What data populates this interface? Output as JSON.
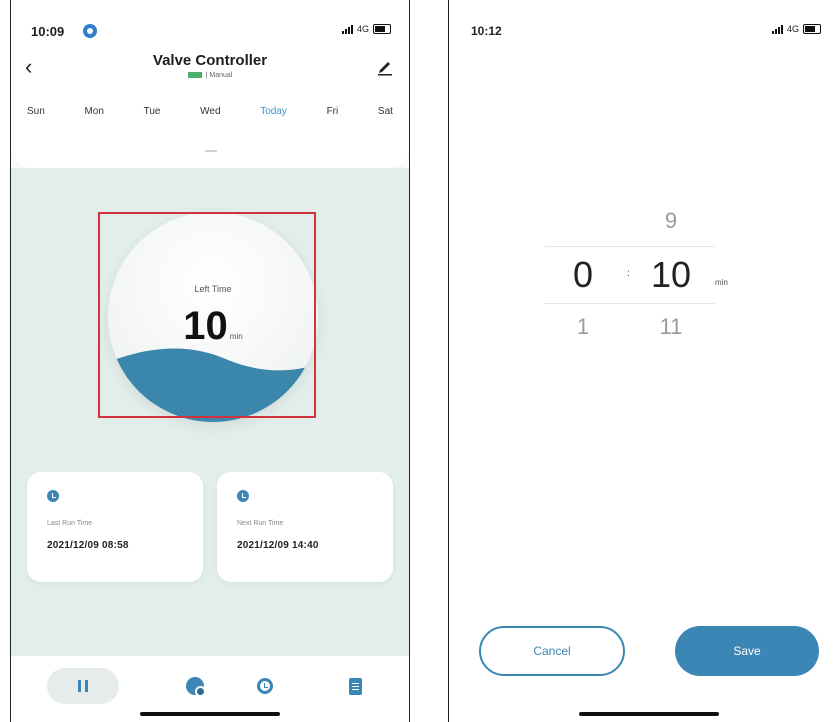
{
  "left_screen": {
    "status": {
      "time": "10:09",
      "network": "4G"
    },
    "header": {
      "title": "Valve Controller",
      "mode": "Manual"
    },
    "days": [
      {
        "label": "Sun",
        "active": false
      },
      {
        "label": "Mon",
        "active": false
      },
      {
        "label": "Tue",
        "active": false
      },
      {
        "label": "Wed",
        "active": false
      },
      {
        "label": "Today",
        "active": true
      },
      {
        "label": "Fri",
        "active": false
      },
      {
        "label": "Sat",
        "active": false
      }
    ],
    "timer": {
      "label": "Left Time",
      "value": "10",
      "unit": "min"
    },
    "last_run": {
      "label": "Last Run Time",
      "value": "2021/12/09 08:58"
    },
    "next_run": {
      "label": "Next Run Time",
      "value": "2021/12/09 14:40"
    },
    "tabs": [
      "pause",
      "timer-icon",
      "alarm-clock-icon",
      "document-icon"
    ]
  },
  "right_screen": {
    "status": {
      "time": "10:12",
      "network": "4G"
    },
    "picker": {
      "hours": {
        "above": "",
        "selected": "0",
        "below": "1"
      },
      "minutes": {
        "above": "9",
        "selected": "10",
        "below": "11"
      },
      "separator": ":",
      "unit": "min"
    },
    "cancel_label": "Cancel",
    "save_label": "Save"
  },
  "colors": {
    "accent": "#3b86b4",
    "background_tint": "#e2eeeb",
    "highlight": "#d2323c",
    "active_day": "#3b94c8"
  }
}
